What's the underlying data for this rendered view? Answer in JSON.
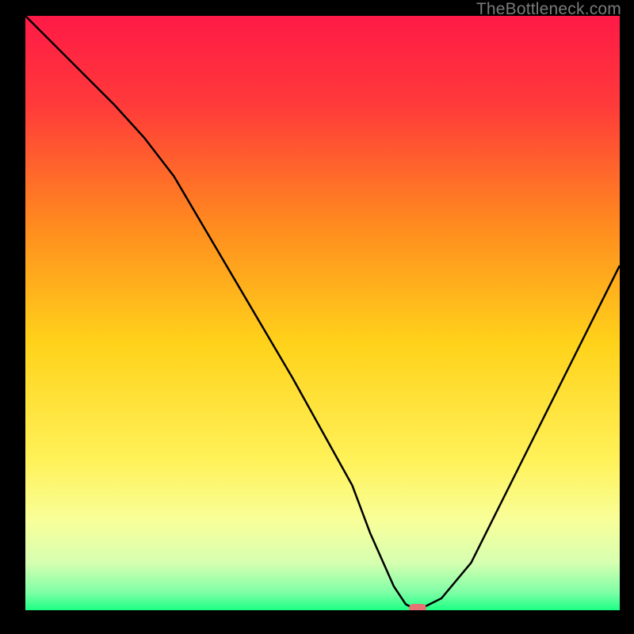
{
  "attribution": "TheBottleneck.com",
  "chart_data": {
    "type": "line",
    "title": "",
    "xlabel": "",
    "ylabel": "",
    "xlim": [
      0,
      100
    ],
    "ylim": [
      0,
      100
    ],
    "grid": false,
    "legend": false,
    "series": [
      {
        "name": "bottleneck-curve",
        "x": [
          0,
          5,
          10,
          15,
          20,
          25,
          30,
          35,
          40,
          45,
          50,
          55,
          58,
          62,
          64,
          66,
          70,
          75,
          80,
          85,
          90,
          95,
          100
        ],
        "values": [
          100,
          95,
          90,
          85,
          79.5,
          73,
          64.5,
          56,
          47.5,
          39,
          30,
          21,
          13,
          4,
          1,
          0,
          2,
          8,
          18,
          28,
          38,
          48,
          58
        ]
      }
    ],
    "marker": {
      "x_pct": 66,
      "y_pct": 0
    },
    "background_gradient": {
      "stops": [
        {
          "offset": 0.0,
          "color": "#ff1a47"
        },
        {
          "offset": 0.15,
          "color": "#ff3a3a"
        },
        {
          "offset": 0.35,
          "color": "#ff8a1f"
        },
        {
          "offset": 0.55,
          "color": "#ffd21a"
        },
        {
          "offset": 0.75,
          "color": "#fff25a"
        },
        {
          "offset": 0.85,
          "color": "#f8ff9a"
        },
        {
          "offset": 0.92,
          "color": "#d6ffb0"
        },
        {
          "offset": 0.97,
          "color": "#7fffa6"
        },
        {
          "offset": 1.0,
          "color": "#1cff84"
        }
      ]
    },
    "colors": {
      "curve_stroke": "#000000",
      "marker_fill": "#e57373",
      "frame_bg": "#000000"
    }
  }
}
